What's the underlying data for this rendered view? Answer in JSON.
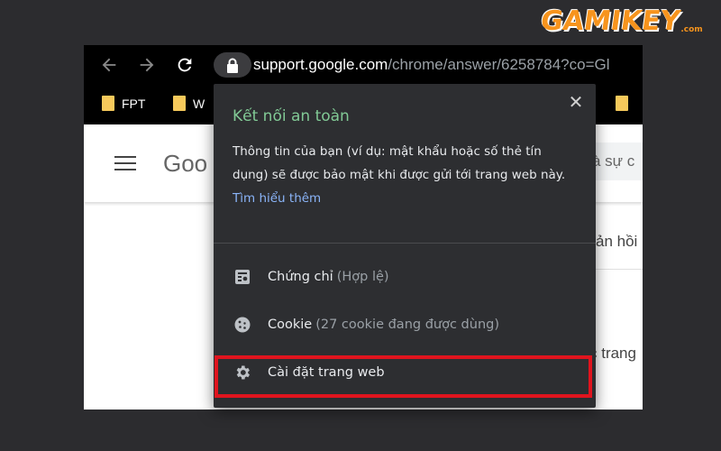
{
  "logo": {
    "text": "GAMIKEY",
    "suffix": ".com"
  },
  "toolbar": {
    "url_host": "support.google.com",
    "url_path": "/chrome/answer/6258784?co=Gl"
  },
  "bookmarks": [
    {
      "label": "FPT"
    },
    {
      "label": "W"
    }
  ],
  "page": {
    "logo_fragment": "Goo",
    "search_fragment": "à sự c",
    "side_text_1": "ản hồi",
    "side_text_2": "c trang"
  },
  "popup": {
    "title": "Kết nối an toàn",
    "close_label": "✕",
    "description": "Thông tin của bạn (ví dụ: mật khẩu hoặc số thẻ tín dụng) sẽ được bảo mật khi được gửi tới trang web này.",
    "learn_more": "Tìm hiểu thêm",
    "items": [
      {
        "label": "Chứng chỉ",
        "detail": "(Hợp lệ)",
        "icon": "certificate-icon"
      },
      {
        "label": "Cookie",
        "detail": "(27 cookie đang được dùng)",
        "icon": "cookie-icon"
      },
      {
        "label": "Cài đặt trang web",
        "detail": "",
        "icon": "gear-icon"
      }
    ]
  },
  "colors": {
    "popup_bg": "#2d2e31",
    "title_green": "#81c995",
    "link_blue": "#8ab4f8",
    "highlight_red": "#e0141e",
    "logo_orange": "#f7941d"
  }
}
